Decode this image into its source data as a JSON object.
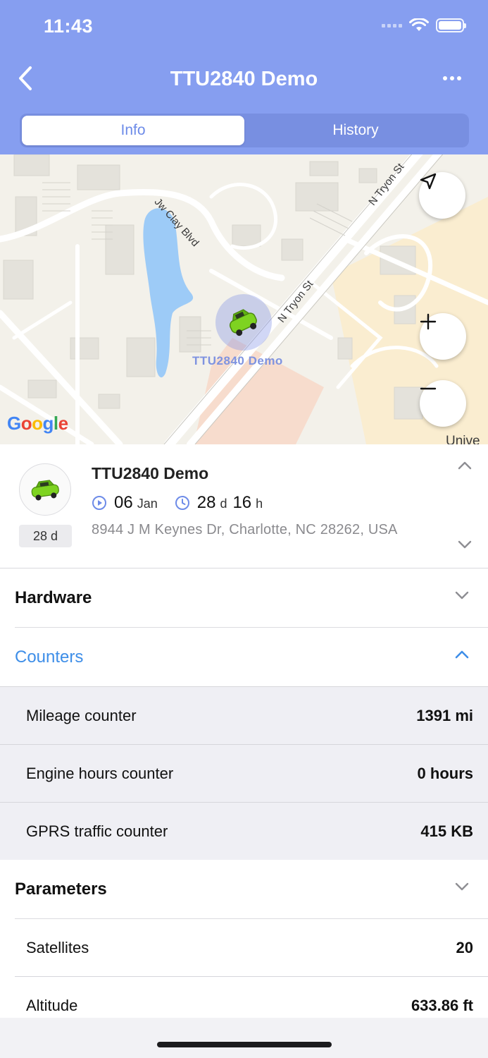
{
  "status_bar": {
    "time": "11:43"
  },
  "nav": {
    "title": "TTU2840 Demo"
  },
  "tabs": [
    {
      "label": "Info",
      "active": true
    },
    {
      "label": "History",
      "active": false
    }
  ],
  "map": {
    "provider_logo": "Google",
    "marker_label": "TTU2840 Demo",
    "streets": [
      "Jw Clay Blvd",
      "N Tryon St",
      "N Tryon St"
    ],
    "corner_text": "Unive",
    "colors": {
      "water": "#9dcbf7",
      "land": "#f3f1ea",
      "campus": "#faedd0",
      "marker": "#7c8ce6"
    }
  },
  "unit": {
    "name": "TTU2840 Demo",
    "age_badge": "28 d",
    "date_day": "06",
    "date_month": "Jan",
    "duration_days": "28",
    "duration_days_unit": "d",
    "duration_hours": "16",
    "duration_hours_unit": "h",
    "address": "8944 J M Keynes Dr, Charlotte, NC 28262, USA"
  },
  "sections": {
    "hardware": {
      "title": "Hardware",
      "expanded": false
    },
    "counters": {
      "title": "Counters",
      "expanded": true,
      "rows": [
        {
          "label": "Mileage counter",
          "value": "1391 mi"
        },
        {
          "label": "Engine hours counter",
          "value": "0 hours"
        },
        {
          "label": "GPRS traffic counter",
          "value": "415 KB"
        }
      ]
    },
    "parameters": {
      "title": "Parameters",
      "expanded": false,
      "rows": [
        {
          "label": "Satellites",
          "value": "20"
        },
        {
          "label": "Altitude",
          "value": "633.86 ft"
        }
      ]
    }
  },
  "theme": {
    "header": "#869ef0",
    "accent": "#3e8ee8",
    "car": "#7ed321"
  }
}
